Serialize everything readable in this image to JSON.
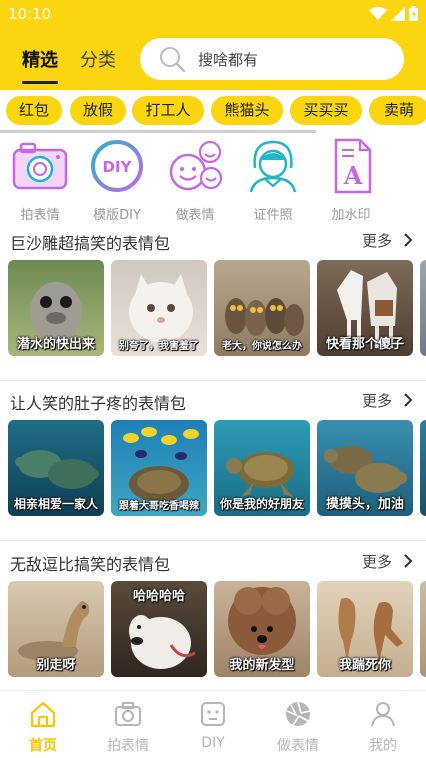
{
  "status": {
    "time": "10:10"
  },
  "header": {
    "tabs": [
      {
        "label": "精选",
        "active": true
      },
      {
        "label": "分类",
        "active": false
      }
    ],
    "search_placeholder": "搜啥都有"
  },
  "chips": [
    "红包",
    "放假",
    "打工人",
    "熊猫头",
    "买买买",
    "卖萌"
  ],
  "tools": [
    {
      "label": "拍表情",
      "icon": "camera-icon"
    },
    {
      "label": "模版DIY",
      "icon": "diy-icon"
    },
    {
      "label": "做表情",
      "icon": "emoji-faces-icon"
    },
    {
      "label": "证件照",
      "icon": "id-photo-icon"
    },
    {
      "label": "加水印",
      "icon": "watermark-icon"
    }
  ],
  "sections": [
    {
      "title": "巨沙雕超搞笑的表情包",
      "more": "更多",
      "items": [
        {
          "caption": "潜水的快出来",
          "scene": "seal"
        },
        {
          "caption": "别夸了，我害羞了",
          "scene": "cat"
        },
        {
          "caption": "老大，你说怎么办",
          "scene": "owls"
        },
        {
          "caption": "快看那个傻子",
          "scene": "horses"
        }
      ]
    },
    {
      "title": "让人笑的肚子疼的表情包",
      "more": "更多",
      "items": [
        {
          "caption": "相亲相爱一家人",
          "scene": "turtles"
        },
        {
          "caption": "跟着大哥吃香喝辣",
          "scene": "reef"
        },
        {
          "caption": "你是我的好朋友",
          "scene": "turtle-single"
        },
        {
          "caption": "摸摸头，加油",
          "scene": "turtle-pair"
        }
      ]
    },
    {
      "title": "无敌逗比搞笑的表情包",
      "more": "更多",
      "items": [
        {
          "caption": "别走呀",
          "scene": "prairie-dog",
          "top_caption": ""
        },
        {
          "caption": "",
          "scene": "alpaca",
          "top_caption": "哈哈哈哈"
        },
        {
          "caption": "我的新发型",
          "scene": "dog"
        },
        {
          "caption": "我踹死你",
          "scene": "kangaroos"
        }
      ]
    }
  ],
  "bottom_nav": [
    {
      "label": "首页",
      "icon": "home-icon",
      "active": true
    },
    {
      "label": "拍表情",
      "icon": "camera-icon",
      "active": false
    },
    {
      "label": "DIY",
      "icon": "diy-face-icon",
      "active": false
    },
    {
      "label": "做表情",
      "icon": "aperture-icon",
      "active": false
    },
    {
      "label": "我的",
      "icon": "profile-icon",
      "active": false
    }
  ],
  "colors": {
    "brand_yellow": "#FBD50F",
    "active_nav": "#FFC400",
    "tool_purple": "#C767E6",
    "tool_teal": "#20B6C9"
  }
}
